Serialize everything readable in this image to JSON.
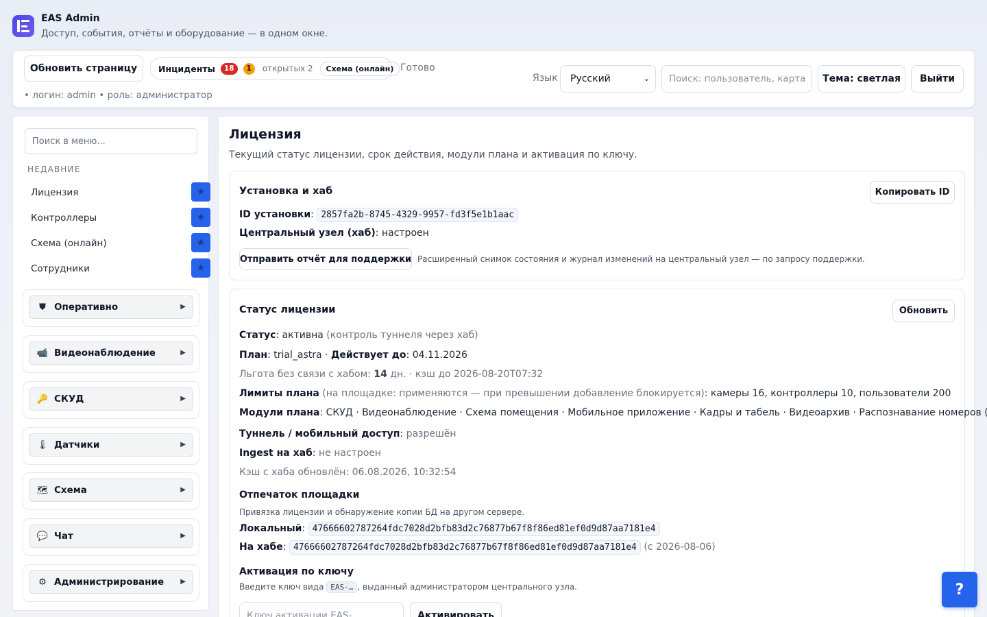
{
  "app": {
    "title": "EAS Admin",
    "subtitle": "Доступ, события, отчёты и оборудование — в одном окне.",
    "logo_icon": "app-logo-icon",
    "accent": "#4f46e5"
  },
  "topbar": {
    "refresh_label": "Обновить страницу",
    "incidents": {
      "label": "Инциденты",
      "count_critical": "18",
      "count_warning": "1",
      "open_text": "открытых 2",
      "schema_chip": "Схема (онлайн)"
    },
    "status_text": "Готово",
    "login_info": "• логин: admin • роль: администратор",
    "language_label": "Язык",
    "language_selected": "Русский",
    "search_placeholder": "Поиск: пользователь, карта",
    "theme_label": "Тема: светлая",
    "logout_label": "Выйти"
  },
  "sidebar": {
    "search_placeholder": "Поиск в меню...",
    "recent_title": "НЕДАВНИЕ",
    "recent": [
      {
        "label": "Лицензия"
      },
      {
        "label": "Контроллеры"
      },
      {
        "label": "Схема (онлайн)"
      },
      {
        "label": "Сотрудники"
      }
    ],
    "star_glyph": "★",
    "groups": [
      {
        "label": "Оперативно",
        "icon": "shield-icon",
        "glyph": "⛊"
      },
      {
        "label": "Видеонаблюдение",
        "icon": "video-camera-icon",
        "glyph": "📹"
      },
      {
        "label": "СКУД",
        "icon": "key-icon",
        "glyph": "🔑"
      },
      {
        "label": "Датчики",
        "icon": "thermometer-icon",
        "glyph": "🌡"
      },
      {
        "label": "Схема",
        "icon": "map-icon",
        "glyph": "🗺"
      },
      {
        "label": "Чат",
        "icon": "chat-bubble-icon",
        "glyph": "💬"
      },
      {
        "label": "Администрирование",
        "icon": "gear-icon",
        "glyph": "⚙"
      }
    ],
    "arrow_glyph": "▶"
  },
  "main": {
    "title": "Лицензия",
    "description": "Текущий статус лицензии, срок действия, модули плана и активация по ключу.",
    "install_card": {
      "title": "Установка и хаб",
      "copy_button": "Копировать ID",
      "install_id_label": "ID установки",
      "install_id": "2857fa2b-8745-4329-9957-fd3f5e1b1aac",
      "hub_label": "Центральный узел (хаб)",
      "hub_value": "настроен",
      "support_button": "Отправить отчёт для поддержки",
      "support_hint": "Расширенный снимок состояния и журнал изменений на центральный узел — по запросу поддержки."
    },
    "status_card": {
      "title": "Статус лицензии",
      "refresh_button": "Обновить",
      "status_label": "Статус",
      "status_value": "активна",
      "status_note": "(контроль туннеля через хаб)",
      "plan_label": "План",
      "plan_value": "trial_astra",
      "valid_label": "Действует до",
      "valid_value": "04.11.2026",
      "grace_prefix": "Льгота без связи с хабом:",
      "grace_days": "14",
      "grace_suffix": "дн. · кэш до 2026-08-20T07:32",
      "limits_label": "Лимиты плана",
      "limits_note": "(на площадке: применяются — при превышении добавление блокируется)",
      "limits_value": "камеры 16, контроллеры 10, пользователи 200",
      "modules_label": "Модули плана",
      "modules_value": "СКУД · Видеонаблюдение · Схема помещения · Мобильное приложение · Кадры и табель · Видеоархив · Распознавание номеров (ANPR)",
      "tunnel_label": "Туннель / мобильный доступ",
      "tunnel_value": "разрешён",
      "ingest_label": "Ingest на хаб",
      "ingest_value": "не настроен",
      "cache_text": "Кэш с хаба обновлён: 06.08.2026, 10:32:54",
      "fingerprint_title": "Отпечаток площадки",
      "fingerprint_hint": "Привязка лицензии и обнаружение копии БД на другом сервере.",
      "local_label": "Локальный",
      "local_value": "47666602787264fdc7028d2bfb83d2c76877b67f8f86ed81ef0d9d87aa7181e4",
      "hub_fp_label": "На хабе",
      "hub_fp_value": "47666602787264fdc7028d2bfb83d2c76877b67f8f86ed81ef0d9d87aa7181e4",
      "hub_fp_since": "(с 2026-08-06)",
      "activation_title": "Активация по ключу",
      "activation_hint_prefix": "Введите ключ вида",
      "activation_key_sample": "EAS-…",
      "activation_hint_suffix": ", выданный администратором центрального узла.",
      "activation_placeholder": "Ключ активации EAS-...",
      "activate_button": "Активировать"
    }
  },
  "help_button": "?"
}
